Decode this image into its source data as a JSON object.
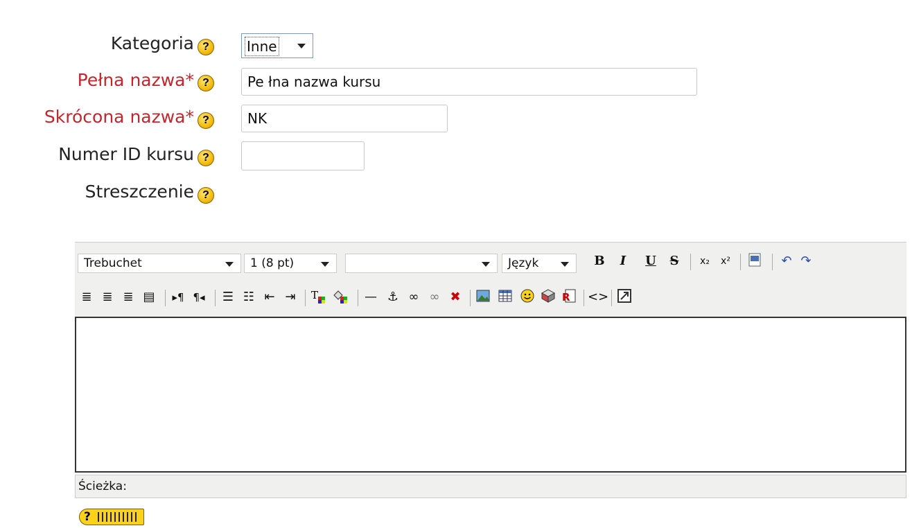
{
  "form": {
    "category": {
      "label": "Kategoria",
      "value": "Inne"
    },
    "fullname": {
      "label": "Pełna nazwa*",
      "value": "Pe łna nazwa kursu"
    },
    "shortname": {
      "label": "Skrócona nazwa*",
      "value": "NK"
    },
    "idnumber": {
      "label": "Numer ID kursu",
      "value": ""
    },
    "summary": {
      "label": "Streszczenie"
    },
    "help_glyph": "?"
  },
  "editor": {
    "font_family": "Trebuchet",
    "font_size": "1 (8 pt)",
    "format": "",
    "language": "Język",
    "bold": "B",
    "italic": "I",
    "underline": "U",
    "strike": "S",
    "subscript": "x₂",
    "superscript": "x²",
    "path_label": "Ścieżka:"
  },
  "icons": {
    "row1": [
      "bold-icon",
      "italic-icon",
      "underline-icon",
      "strikethrough-icon",
      "subscript-icon",
      "superscript-icon",
      "paste-word-icon",
      "undo-icon",
      "redo-icon"
    ],
    "row2": [
      "align-left-icon",
      "align-center-icon",
      "align-right-icon",
      "justify-icon",
      "ltr-icon",
      "rtl-icon",
      "numbered-list-icon",
      "bullet-list-icon",
      "outdent-icon",
      "indent-icon",
      "text-color-icon",
      "background-color-icon",
      "horizontal-rule-icon",
      "anchor-icon",
      "link-icon",
      "unlink-icon",
      "nolink-icon",
      "image-icon",
      "table-icon",
      "smiley-icon",
      "special-char-icon",
      "search-replace-icon",
      "html-source-icon",
      "fullscreen-icon"
    ]
  }
}
